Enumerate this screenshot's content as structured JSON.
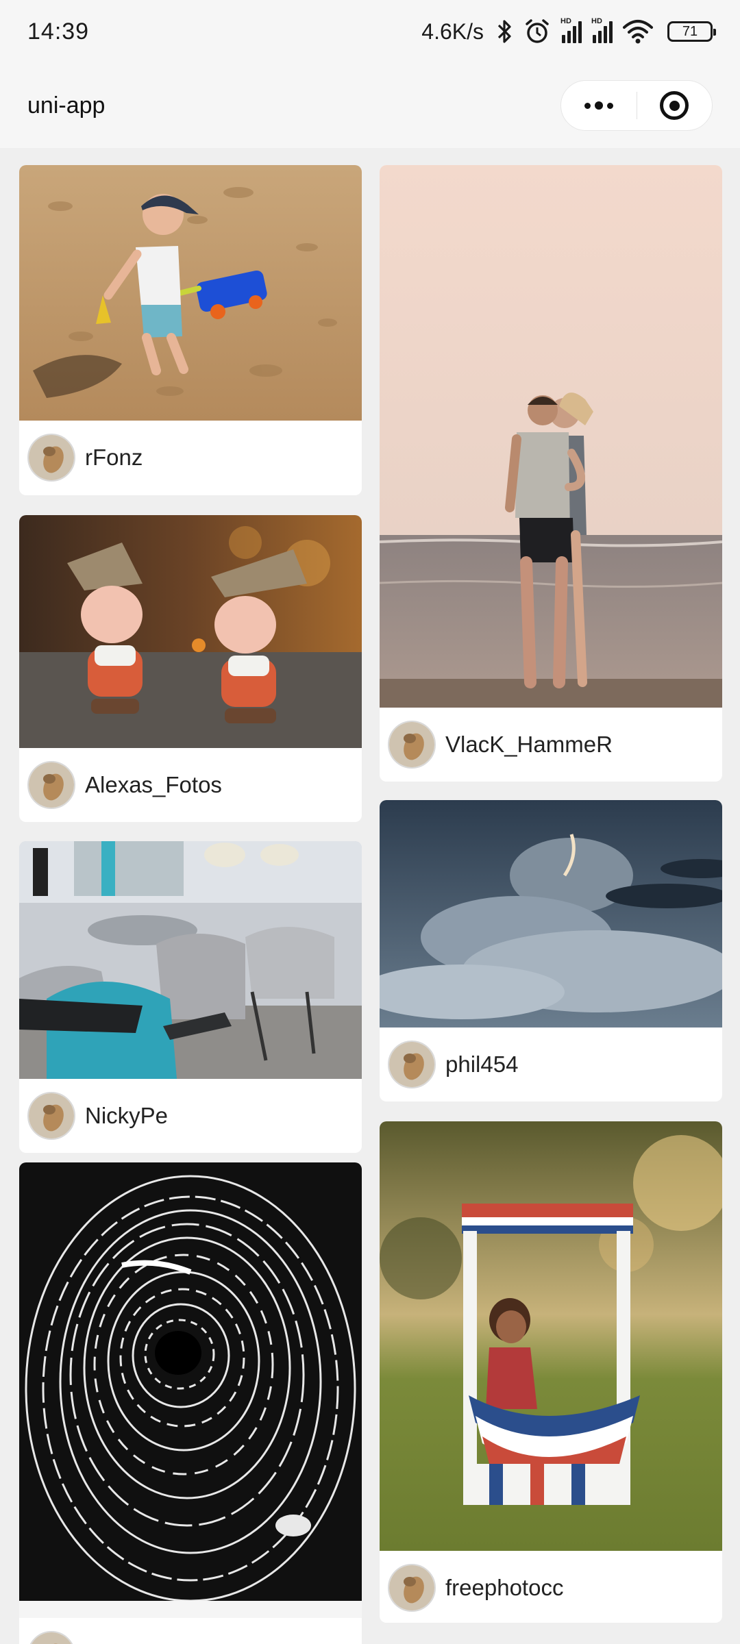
{
  "status_bar": {
    "time": "14:39",
    "net_speed": "4.6K/s",
    "hd_label": "HD",
    "battery": "71",
    "icons": [
      "bluetooth-icon",
      "alarm-icon",
      "signal-icon",
      "signal-icon",
      "wifi-icon",
      "battery-icon"
    ]
  },
  "nav": {
    "title": "uni-app",
    "capsule": [
      "more-dots-icon",
      "close-target-icon"
    ]
  },
  "cards": [
    {
      "author": "rFonz",
      "photo": "child playing in sand with blue toy wagon",
      "photo_icon": "photo-sand-beach"
    },
    {
      "author": "VlacK_HammeR",
      "photo": "couple embracing on seashore at dusk",
      "photo_icon": "photo-couple-sea"
    },
    {
      "author": "Alexas_Fotos",
      "photo": "two gnome figurines with knitted hats",
      "photo_icon": "photo-gnomes"
    },
    {
      "author": "phil454",
      "photo": "storm clouds over grey sky",
      "photo_icon": "photo-clouds"
    },
    {
      "author": "NickyPe",
      "photo": "outdoor cafe chairs and tables",
      "photo_icon": "photo-cafe-chairs"
    },
    {
      "author": "freephotocc",
      "photo": "girl at patriotic lemonade stand",
      "photo_icon": "photo-stand"
    },
    {
      "author": "",
      "photo": "black and white swirling vortex engraving",
      "photo_icon": "photo-vortex"
    }
  ],
  "colors": {
    "page_bg": "#efefef",
    "bar_bg": "#f6f6f6",
    "card_bg": "#ffffff",
    "text": "#222222"
  }
}
